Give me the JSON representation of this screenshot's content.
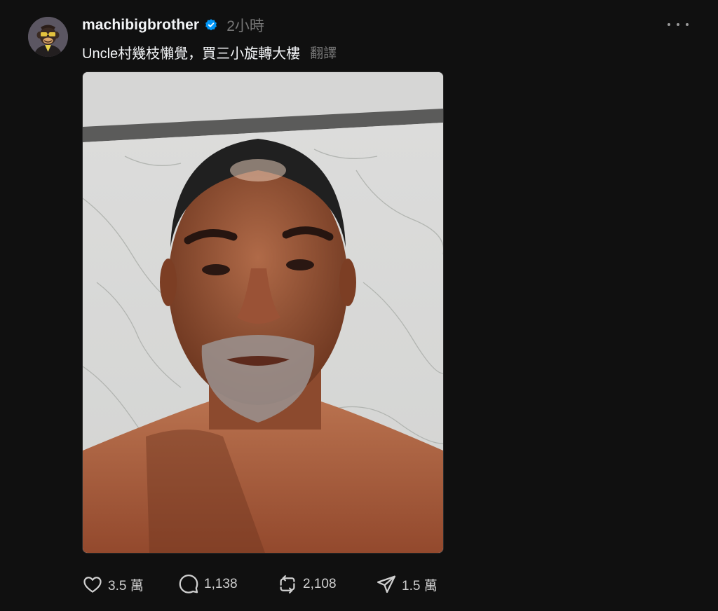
{
  "post": {
    "username": "machibigbrother",
    "timestamp": "2小時",
    "caption": "Uncle村幾枝懶覺，買三小旋轉大樓",
    "translate_label": "翻譯",
    "image_alt": "selfie photo of a bald man with grey goatee in front of marble wall"
  },
  "actions": {
    "likes": "3.5 萬",
    "replies": "1,138",
    "reposts": "2,108",
    "shares": "1.5 萬"
  },
  "colors": {
    "background": "#101010",
    "primary_text": "#f3f5f7",
    "secondary_text": "#777777",
    "verified": "#0095f6"
  }
}
